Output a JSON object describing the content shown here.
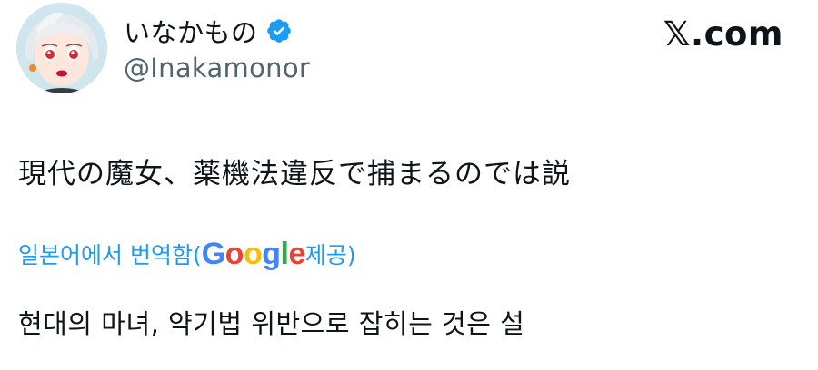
{
  "author": {
    "display_name": "いなかもの",
    "handle": "@Inakamonor",
    "verified": true
  },
  "site": {
    "logo_text": "𝕏.com"
  },
  "tweet": {
    "text": "現代の魔女、薬機法違反で捕まるのでは説"
  },
  "translation": {
    "prefix": "일본어에서 번역함(",
    "google_letters": [
      "G",
      "o",
      "o",
      "g",
      "l",
      "e"
    ],
    "suffix": " 제공)",
    "text": "현대의 마녀, 약기법 위반으로 잡히는 것은 설"
  },
  "colors": {
    "accent": "#1d9bf0",
    "text": "#0f1419",
    "secondary": "#536471"
  },
  "icons": {
    "verified": "verified-badge-icon",
    "avatar": "anime-character-avatar"
  }
}
